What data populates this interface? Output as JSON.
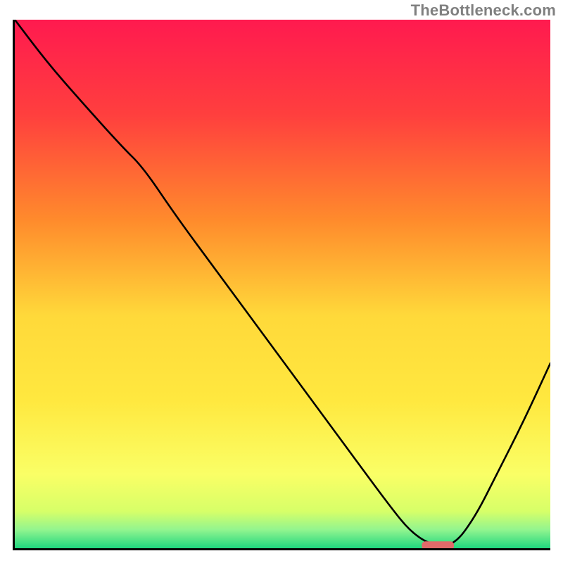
{
  "watermark": "TheBottleneck.com",
  "chart_data": {
    "type": "line",
    "title": "",
    "xlabel": "",
    "ylabel": "",
    "xlim": [
      0,
      100
    ],
    "ylim": [
      0,
      100
    ],
    "grid": false,
    "legend": false,
    "background": {
      "type": "vertical-gradient",
      "stops": [
        {
          "pos": 0.0,
          "color": "#ff1a4f"
        },
        {
          "pos": 0.18,
          "color": "#ff3f3e"
        },
        {
          "pos": 0.38,
          "color": "#ff8b2c"
        },
        {
          "pos": 0.56,
          "color": "#ffd93a"
        },
        {
          "pos": 0.72,
          "color": "#ffe83f"
        },
        {
          "pos": 0.86,
          "color": "#faff66"
        },
        {
          "pos": 0.93,
          "color": "#d7ff68"
        },
        {
          "pos": 0.965,
          "color": "#92f58f"
        },
        {
          "pos": 1.0,
          "color": "#1fd67f"
        }
      ]
    },
    "series": [
      {
        "name": "bottleneck-curve",
        "x": [
          0,
          6,
          12,
          20,
          24,
          30,
          38,
          46,
          54,
          62,
          70,
          74,
          78,
          82,
          86,
          90,
          95,
          100
        ],
        "values": [
          100,
          92,
          85,
          76,
          72,
          63,
          52,
          41,
          30,
          19,
          8,
          3,
          0.5,
          0.5,
          6,
          14,
          24,
          35
        ]
      }
    ],
    "marker": {
      "name": "optimal-range",
      "shape": "rounded-rect",
      "x_start": 76,
      "x_end": 82,
      "y": 0.5,
      "color": "#e26a6a"
    }
  }
}
